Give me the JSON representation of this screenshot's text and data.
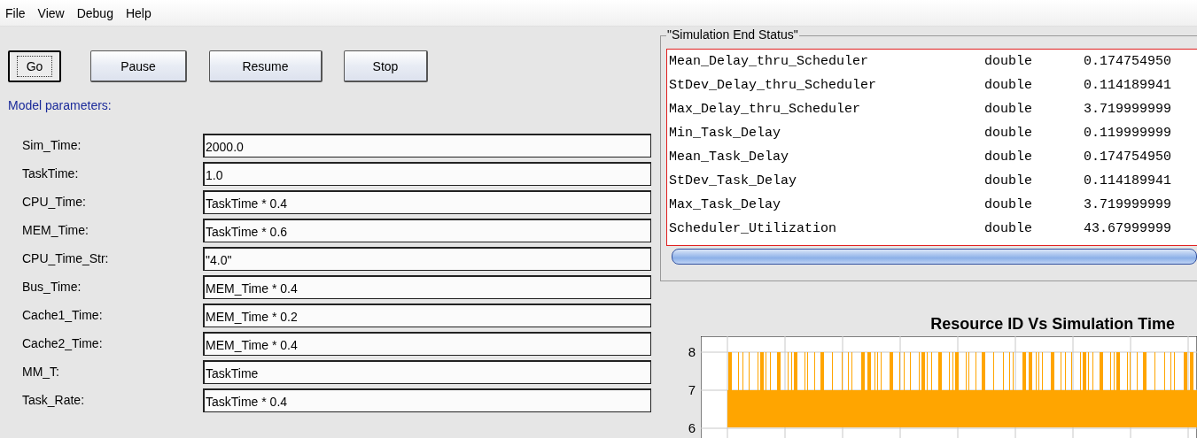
{
  "menu": [
    "File",
    "View",
    "Debug",
    "Help"
  ],
  "buttons": [
    {
      "label": "Go",
      "focused": true
    },
    {
      "label": "Pause",
      "focused": false
    },
    {
      "label": "Resume",
      "focused": false
    },
    {
      "label": "Stop",
      "focused": false
    }
  ],
  "section_title": "Model parameters:",
  "parameters": [
    {
      "label": "Sim_Time:",
      "value": "2000.0"
    },
    {
      "label": "TaskTime:",
      "value": "1.0"
    },
    {
      "label": "CPU_Time:",
      "value": "TaskTime * 0.4"
    },
    {
      "label": "MEM_Time:",
      "value": "TaskTime * 0.6"
    },
    {
      "label": "CPU_Time_Str:",
      "value": "\"4.0\""
    },
    {
      "label": "Bus_Time:",
      "value": "MEM_Time * 0.4"
    },
    {
      "label": "Cache1_Time:",
      "value": "MEM_Time * 0.2"
    },
    {
      "label": "Cache2_Time:",
      "value": "MEM_Time * 0.4"
    },
    {
      "label": "MM_T:",
      "value": "TaskTime"
    },
    {
      "label": "Task_Rate:",
      "value": "TaskTime * 0.4"
    }
  ],
  "status_panel": {
    "title": "\"Simulation End Status\"",
    "rows": [
      [
        "Mean_Delay_thru_Scheduler",
        "double",
        "0.174754950"
      ],
      [
        "StDev_Delay_thru_Scheduler",
        "double",
        "0.114189941"
      ],
      [
        "Max_Delay_thru_Scheduler",
        "double",
        "3.719999999"
      ],
      [
        "Min_Task_Delay",
        "double",
        "0.119999999"
      ],
      [
        "Mean_Task_Delay",
        "double",
        "0.174754950"
      ],
      [
        "StDev_Task_Delay",
        "double",
        "0.114189941"
      ],
      [
        "Max_Task_Delay",
        "double",
        "3.719999999"
      ],
      [
        "Scheduler_Utilization",
        "double",
        "43.67999999"
      ]
    ]
  },
  "chart": {
    "title": "Resource ID Vs Simulation Time",
    "y_tick_labels": [
      "8",
      "7",
      "6"
    ]
  }
}
